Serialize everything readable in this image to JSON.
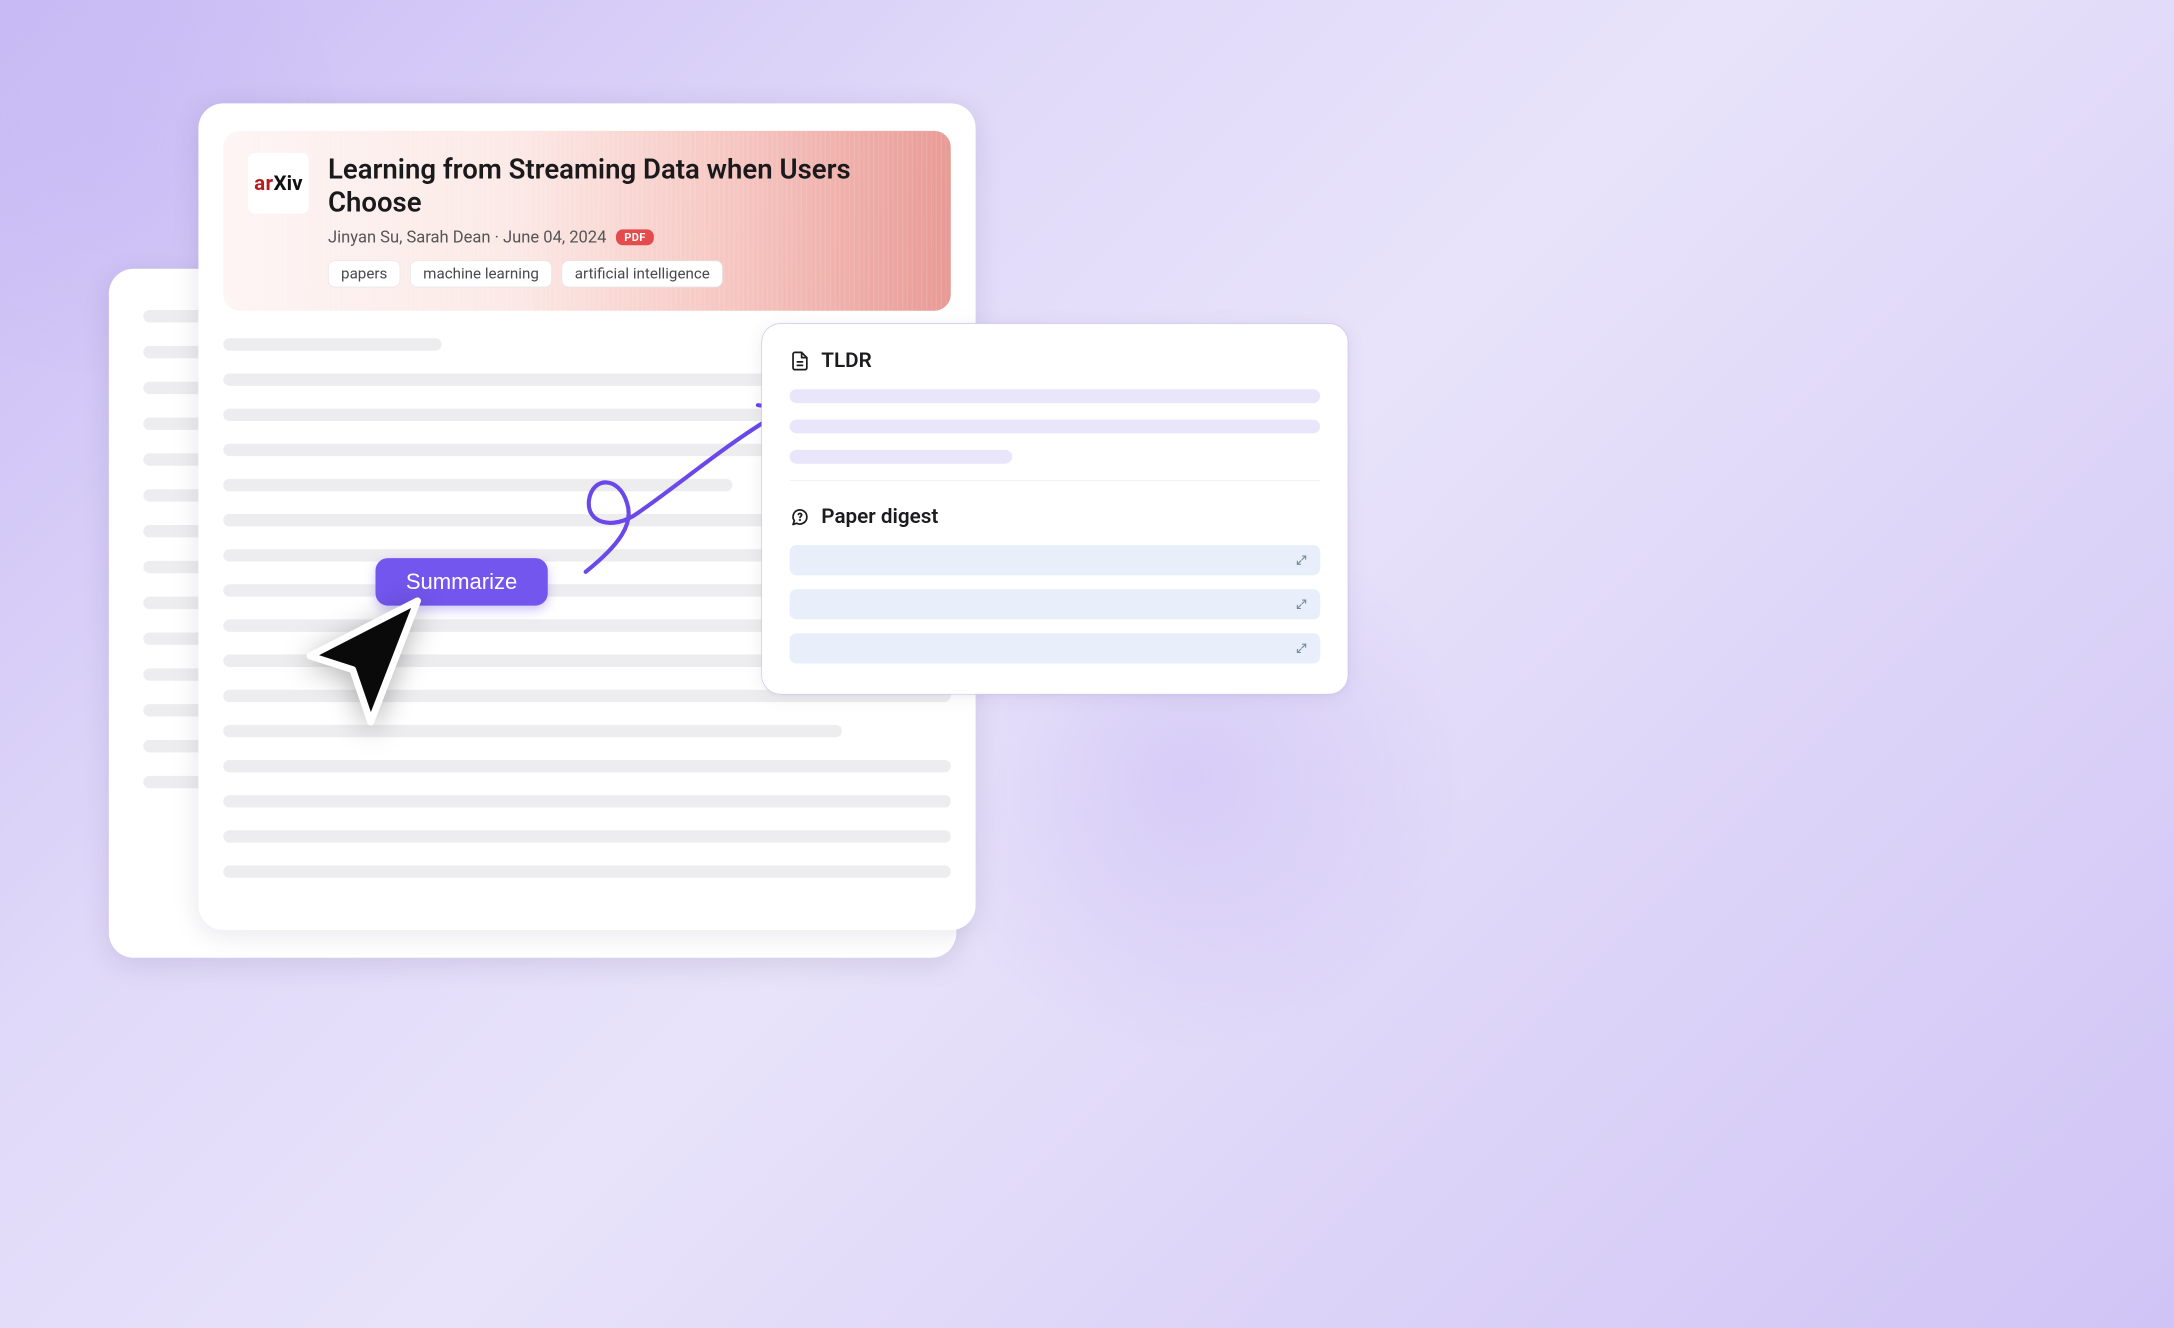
{
  "paper": {
    "source_badge_prefix": "ar",
    "source_badge_suffix": "Xiv",
    "title": "Learning from Streaming Data when Users Choose",
    "authors_and_date": "Jinyan Su, Sarah Dean · June 04, 2024",
    "format_badge": "PDF",
    "tags": [
      "papers",
      "machine learning",
      "artificial intelligence"
    ]
  },
  "actions": {
    "summarize_label": "Summarize"
  },
  "summary_panel": {
    "tldr_heading": "TLDR",
    "digest_heading": "Paper digest"
  }
}
